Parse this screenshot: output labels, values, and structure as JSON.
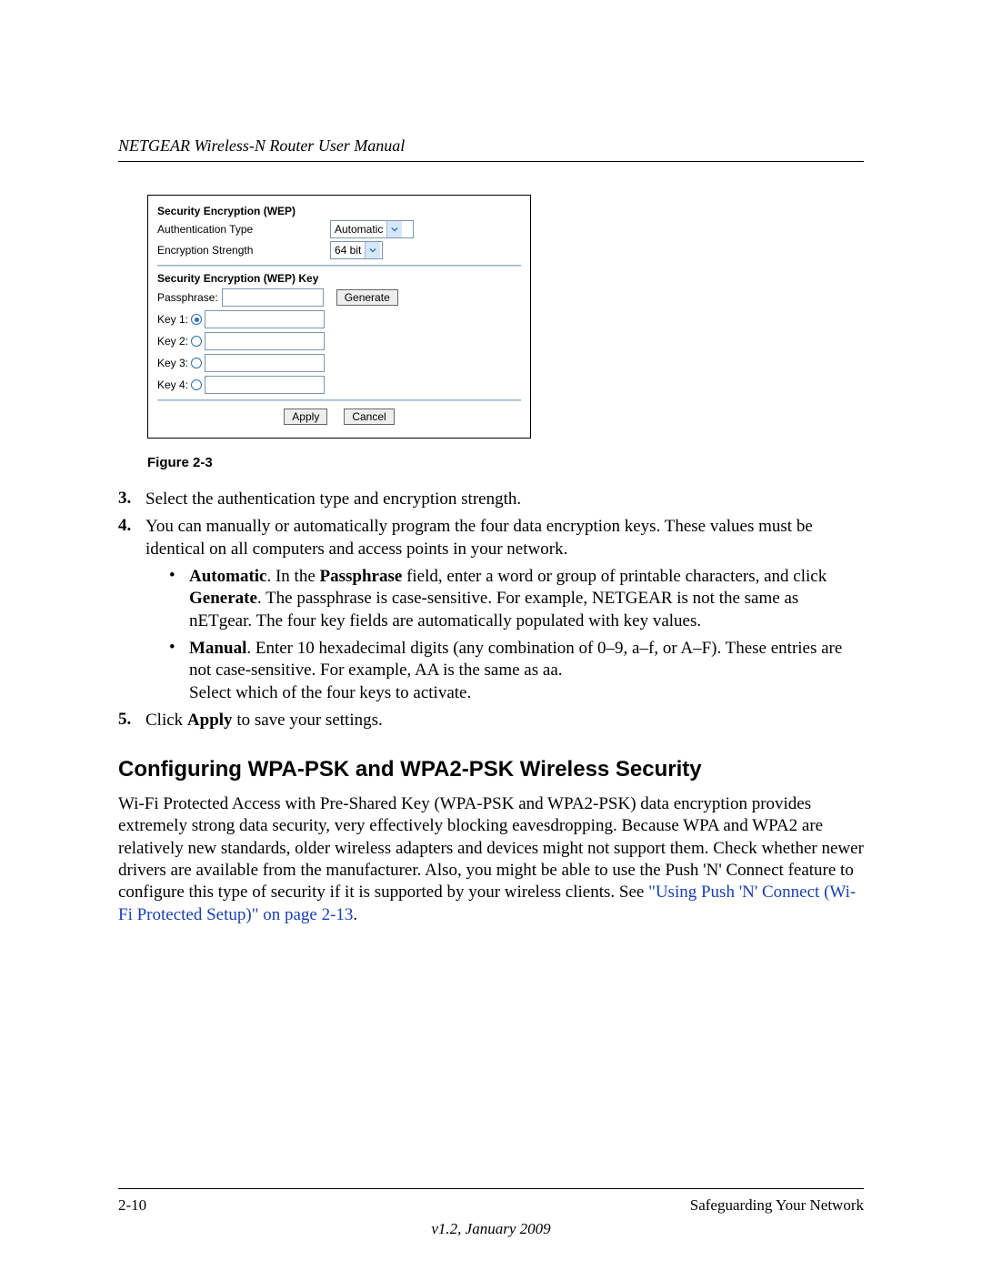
{
  "header": {
    "title": "NETGEAR Wireless-N Router User Manual"
  },
  "figure": {
    "caption": "Figure 2-3",
    "section1_title": "Security Encryption (WEP)",
    "auth_label": "Authentication Type",
    "auth_value": "Automatic",
    "enc_label": "Encryption Strength",
    "enc_value": "64 bit",
    "section2_title": "Security Encryption (WEP) Key",
    "passphrase_label": "Passphrase:",
    "generate_label": "Generate",
    "key1_label": "Key 1:",
    "key2_label": "Key 2:",
    "key3_label": "Key 3:",
    "key4_label": "Key 4:",
    "apply_label": "Apply",
    "cancel_label": "Cancel"
  },
  "steps": {
    "n3": "3.",
    "t3": "Select the authentication type and encryption strength.",
    "n4": "4.",
    "t4": "You can manually or automatically program the four data encryption keys. These values must be identical on all computers and access points in your network.",
    "bullet_auto_b1": "Automatic",
    "bullet_auto_t1": ". In the ",
    "bullet_auto_b2": "Passphrase",
    "bullet_auto_t2": " field, enter a word or group of printable characters, and click ",
    "bullet_auto_b3": "Generate",
    "bullet_auto_t3": ". The passphrase is case-sensitive. For example, NETGEAR is not the same as nETgear. The four key fields are automatically populated with key values.",
    "bullet_manual_b1": "Manual",
    "bullet_manual_t1": ". Enter 10 hexadecimal digits (any combination of 0–9, a–f, or A–F). These entries are not case-sensitive. For example, AA is the same as aa.",
    "bullet_manual_t2": "Select which of the four keys to activate.",
    "n5": "5.",
    "t5a": "Click ",
    "t5b": "Apply",
    "t5c": " to save your settings."
  },
  "section_heading": "Configuring WPA-PSK and WPA2-PSK Wireless Security",
  "para_main": "Wi-Fi Protected Access with Pre-Shared Key (WPA-PSK and WPA2-PSK) data encryption provides extremely strong data security, very effectively blocking eavesdropping. Because WPA and WPA2 are relatively new standards, older wireless adapters and devices might not support them. Check whether newer drivers are available from the manufacturer. Also, you might be able to use the Push 'N' Connect feature to configure this type of security if it is supported by your wireless clients. See ",
  "link_text": "\"Using Push 'N' Connect (Wi-Fi Protected Setup)\" on page 2-13",
  "para_end": ".",
  "footer": {
    "left": "2-10",
    "right": "Safeguarding Your Network",
    "version": "v1.2, January 2009"
  }
}
